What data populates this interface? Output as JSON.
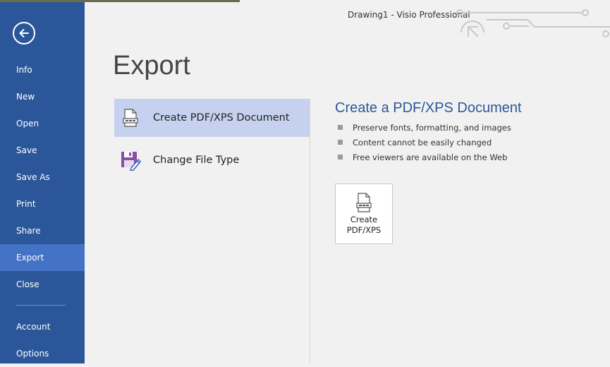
{
  "window": {
    "title": "Drawing1 - Visio Professional"
  },
  "sidebar": {
    "items": [
      {
        "label": "Info"
      },
      {
        "label": "New"
      },
      {
        "label": "Open"
      },
      {
        "label": "Save"
      },
      {
        "label": "Save As"
      },
      {
        "label": "Print"
      },
      {
        "label": "Share"
      },
      {
        "label": "Export"
      },
      {
        "label": "Close"
      },
      {
        "label": "Account"
      },
      {
        "label": "Options"
      }
    ],
    "active": "Export"
  },
  "main": {
    "heading": "Export",
    "options": [
      {
        "label": "Create PDF/XPS Document",
        "icon": "pdf-document-icon"
      },
      {
        "label": "Change File Type",
        "icon": "save-change-type-icon"
      }
    ],
    "selected_option": "Create PDF/XPS Document"
  },
  "panel": {
    "title": "Create a PDF/XPS Document",
    "bullets": [
      "Preserve fonts, formatting, and images",
      "Content cannot be easily changed",
      "Free viewers are available on the Web"
    ],
    "button": {
      "line1": "Create",
      "line2": "PDF/XPS"
    }
  },
  "colors": {
    "sidebar": "#2b579a",
    "active_item": "#4472c4",
    "accent_text": "#2b579a",
    "selected_option": "#c5d1ee"
  }
}
